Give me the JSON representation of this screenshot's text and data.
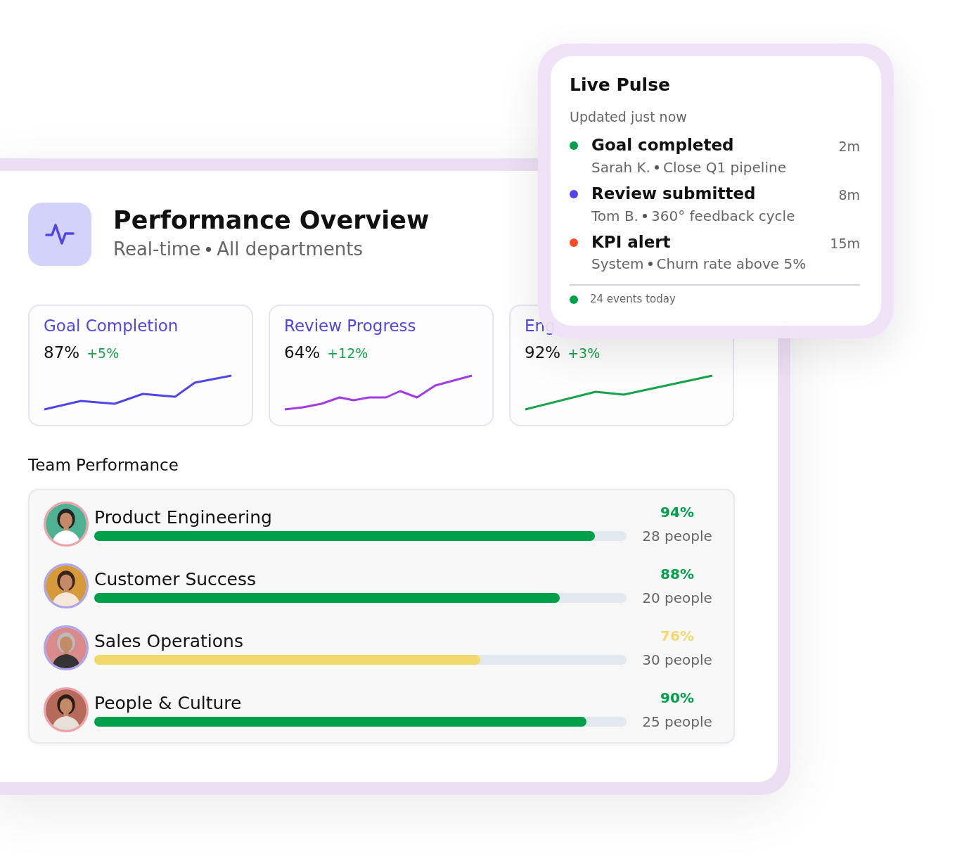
{
  "header": {
    "title": "Performance Overview",
    "subtitle_left": "Real-time",
    "subtitle_right": "All departments"
  },
  "metrics": [
    {
      "title": "Goal Completion",
      "value": "87%",
      "change": "+5%",
      "color": "#4f46e5"
    },
    {
      "title": "Review Progress",
      "value": "64%",
      "change": "+12%",
      "color": "#a13ce6"
    },
    {
      "title": "Eng",
      "value": "92%",
      "change": "+3%",
      "color": "#16a34a"
    }
  ],
  "team_section": {
    "title": "Team Performance"
  },
  "teams": [
    {
      "name": "Product Engineering",
      "level": 0.94,
      "percent": "94%",
      "people": "28 people",
      "color": "#00a04a"
    },
    {
      "name": "Customer Success",
      "level": 0.875,
      "percent": "88%",
      "people": "20 people",
      "color": "#00a04a"
    },
    {
      "name": "Sales Operations",
      "level": 0.725,
      "percent": "76%",
      "people": "30 people",
      "color": "#f2d96b"
    },
    {
      "name": "People & Culture",
      "level": 0.925,
      "percent": "90%",
      "people": "25 people",
      "color": "#00a04a"
    }
  ],
  "live_pulse": {
    "title": "Live Pulse",
    "updated": "Updated just now",
    "events": [
      {
        "title": "Goal completed",
        "detail_left": "Sarah K.",
        "detail_right": "Close Q1 pipeline",
        "time": "2m",
        "color": "#00a04a"
      },
      {
        "title": "Review submitted",
        "detail_left": "Tom B.",
        "detail_right": "360° feedback cycle",
        "time": "8m",
        "color": "#4f46e5"
      },
      {
        "title": "KPI alert",
        "detail_left": "System",
        "detail_right": "Churn rate above 5%",
        "time": "15m",
        "color": "#ff4a2a"
      }
    ],
    "footer": {
      "text": "24 events today",
      "color": "#00a04a"
    }
  }
}
